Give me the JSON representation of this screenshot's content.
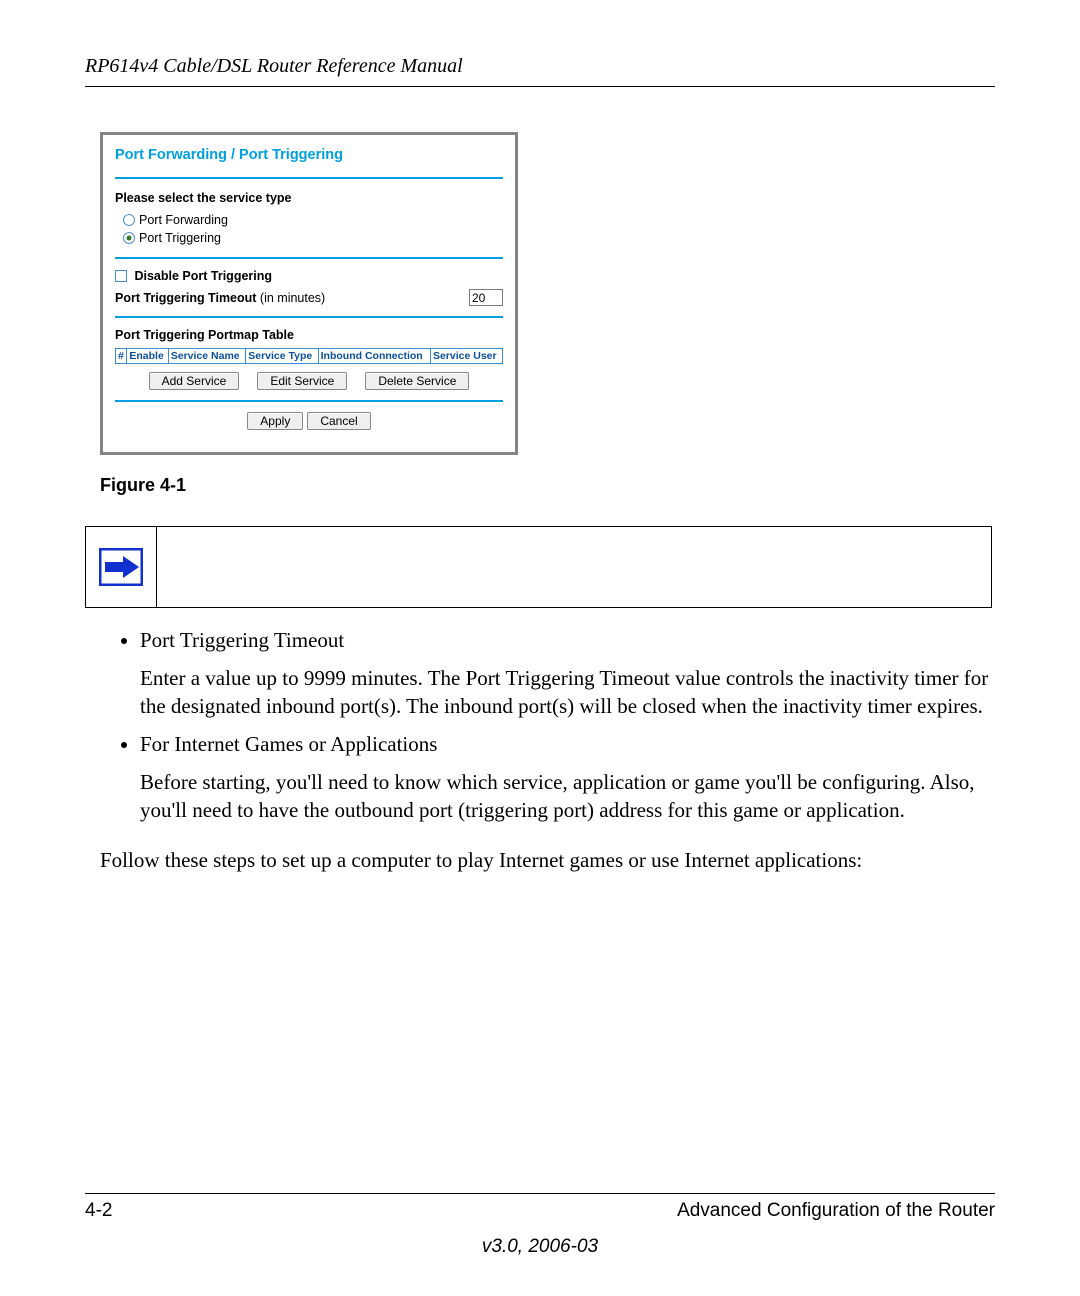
{
  "header": {
    "running": "RP614v4 Cable/DSL Router Reference Manual"
  },
  "screenshot": {
    "title": "Port Forwarding / Port Triggering",
    "service_type_label": "Please select the service type",
    "radios": {
      "forwarding": "Port Forwarding",
      "triggering": "Port Triggering"
    },
    "disable_label": "Disable Port Triggering",
    "timeout_label_bold": "Port Triggering Timeout",
    "timeout_label_rest": " (in minutes)",
    "timeout_value": "20",
    "portmap_label": "Port Triggering Portmap Table",
    "columns": [
      "#",
      "Enable",
      "Service Name",
      "Service Type",
      "Inbound Connection",
      "Service User"
    ],
    "buttons": {
      "add": "Add Service",
      "edit": "Edit Service",
      "del": "Delete Service",
      "apply": "Apply",
      "cancel": "Cancel"
    }
  },
  "figure_caption": "Figure 4-1",
  "bullets": {
    "item1": {
      "term": "Port Triggering Timeout",
      "desc": "Enter a value up to 9999 minutes. The Port Triggering Timeout value controls the inactivity timer for the designated inbound port(s). The inbound port(s) will be closed when the inactivity timer expires."
    },
    "item2": {
      "term": "For Internet Games or Applications",
      "desc": "Before starting, you'll need to know which service, application or game you'll be configuring. Also, you'll need to have the outbound port (triggering port) address for this game or application."
    }
  },
  "body_follow": "Follow these steps to set up a computer to play Internet games or use Internet applications:",
  "footer": {
    "page": "4-2",
    "section": "Advanced Configuration of the Router",
    "version": "v3.0, 2006-03"
  }
}
